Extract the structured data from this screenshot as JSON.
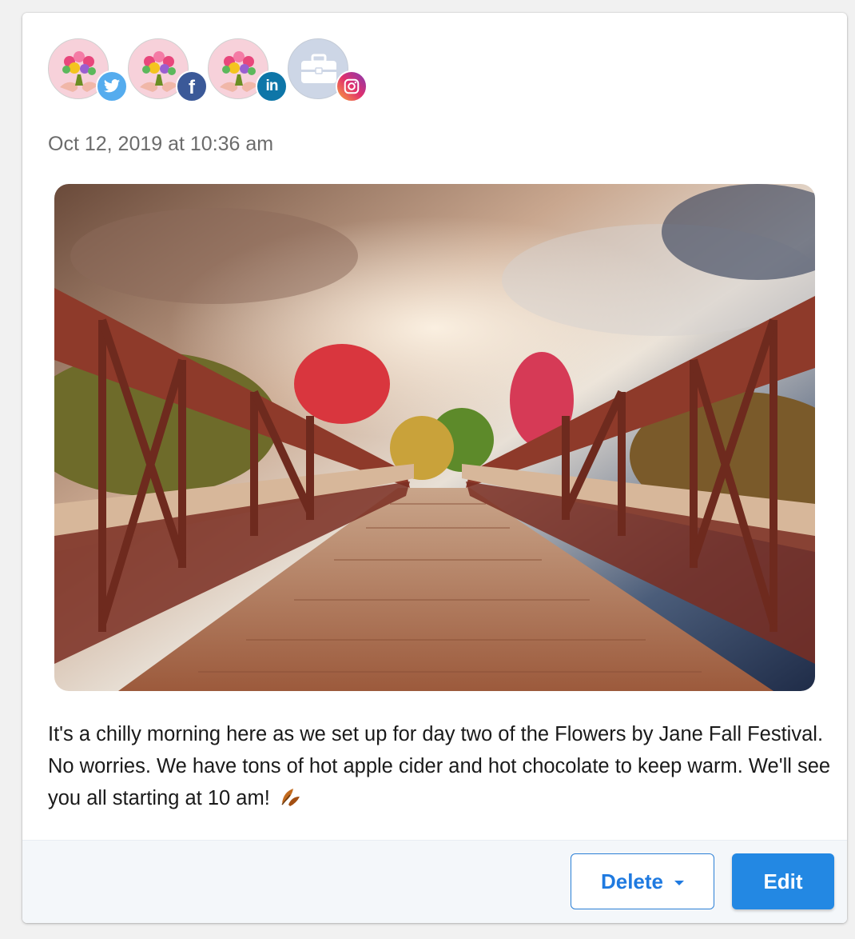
{
  "post": {
    "accounts": [
      {
        "avatar": "flower-bouquet-avatar",
        "network": "twitter",
        "color": "#55acee"
      },
      {
        "avatar": "flower-bouquet-avatar",
        "network": "facebook",
        "color": "#3b5998"
      },
      {
        "avatar": "flower-bouquet-avatar",
        "network": "linkedin",
        "color": "#0e76a8"
      },
      {
        "avatar": "briefcase-avatar",
        "network": "instagram",
        "color": "#c13584"
      }
    ],
    "timestamp": "Oct 12, 2019 at 10:36 am",
    "image": "autumn-wooden-bridge-photo",
    "text": "It's a chilly morning here as we set up for day two of the Flowers by Jane Fall Festival. No worries. We have tons of hot apple cider and hot chocolate to keep warm. We'll see you all starting at 10 am!",
    "emoji": "fallen-leaf-icon"
  },
  "actions": {
    "delete_label": "Delete",
    "edit_label": "Edit"
  },
  "colors": {
    "primary": "#2388e3",
    "primary_text": "#1f7ae0",
    "footer_bg": "#f4f7fa"
  }
}
